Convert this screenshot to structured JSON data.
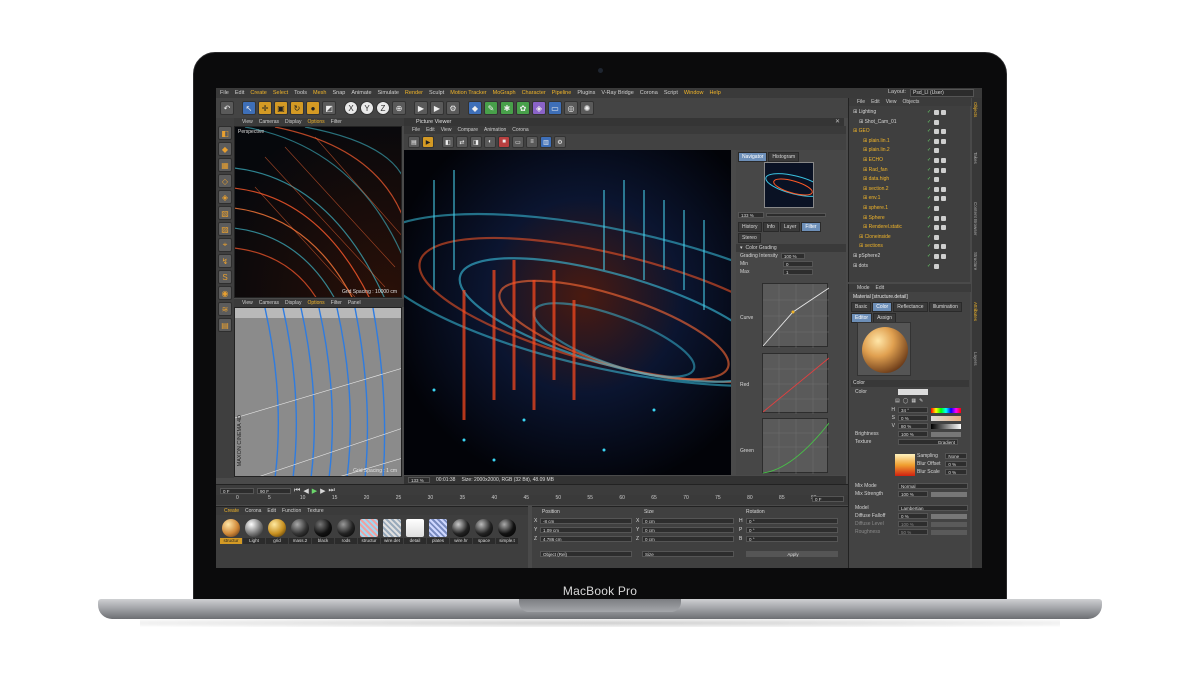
{
  "device": {
    "label": "MacBook Pro"
  },
  "menu": [
    "File",
    "Edit",
    "Create",
    "Select",
    "Tools",
    "Mesh",
    "Snap",
    "Animate",
    "Simulate",
    "Render",
    "Sculpt",
    "Motion Tracker",
    "MoGraph",
    "Character",
    "Pipeline",
    "Plugins",
    "V-Ray Bridge",
    "Corona",
    "Script",
    "Window",
    "Help"
  ],
  "menu_highlight": [
    "Create",
    "Select",
    "Mesh",
    "Render",
    "Motion Tracker",
    "MoGraph",
    "Character",
    "Pipeline",
    "Window",
    "Help"
  ],
  "layout": {
    "label": "Layout:",
    "value": "Psd_LI (User)"
  },
  "viewport_top": {
    "menu": [
      "View",
      "Cameras",
      "Display",
      "Options",
      "Filter"
    ],
    "label": "Perspective",
    "grid": "Grid Spacing : 10000 cm"
  },
  "viewport_bottom": {
    "menu": [
      "View",
      "Cameras",
      "Display",
      "Options",
      "Filter",
      "Panel"
    ],
    "grid": "Grid Spacing : 1 cm",
    "brand": "MAXON CINEMA 4D"
  },
  "picture_viewer": {
    "title": "Picture Viewer",
    "menu": [
      "File",
      "Edit",
      "View",
      "Compare",
      "Animation",
      "Corona"
    ],
    "tabs": [
      "Navigator",
      "Histogram"
    ],
    "zoom": "133 %",
    "subtabs": [
      "History",
      "Info",
      "Layer",
      "Filter",
      "Stereo"
    ],
    "section": "Color Grading",
    "grading_label": "Grading Intensity",
    "grading_value": "100 %",
    "min_label": "Min",
    "min_value": "0",
    "max_label": "Max",
    "max_value": "1",
    "curve_label": "Curve",
    "red_label": "Red",
    "green_label": "Green",
    "status_zoom": "133 %",
    "time": "00:01:38",
    "size_info": "Size: 2000x2000, RGB (32 Bit), 48.09 MB"
  },
  "timeline": {
    "start": "0 F",
    "end": "90 F",
    "ticks": [
      "0",
      "5",
      "10",
      "15",
      "20",
      "25",
      "30",
      "35",
      "40",
      "45",
      "50",
      "55",
      "60",
      "65",
      "70",
      "75",
      "80",
      "85",
      "90"
    ],
    "frame": "0 F"
  },
  "materials": {
    "tabs": [
      "Create",
      "Corona",
      "Edit",
      "Function",
      "Texture"
    ],
    "items": [
      "structur",
      "Light",
      "grid",
      "mass.2",
      "black",
      "rods",
      "structur",
      "wire.det",
      "detail",
      "plates",
      "wire.hr",
      "space",
      "simple.t"
    ]
  },
  "coordinates": {
    "headers": [
      "Position",
      "Size",
      "Rotation"
    ],
    "rows": [
      {
        "axis": "X",
        "pos": "-8 cm",
        "size": "0 cm",
        "rot_axis": "H",
        "rot": "0 °"
      },
      {
        "axis": "Y",
        "pos": "1.09 cm",
        "size": "0 cm",
        "rot_axis": "P",
        "rot": "0 °"
      },
      {
        "axis": "Z",
        "pos": "4.786 cm",
        "size": "0 cm",
        "rot_axis": "B",
        "rot": "0 °"
      }
    ],
    "mode": "Object (Rel)",
    "size_mode": "Size",
    "apply": "Apply"
  },
  "objects": {
    "menu": [
      "File",
      "Edit",
      "View",
      "Objects"
    ],
    "items": [
      "Lighting",
      "Shot_Cam_01",
      "GEO",
      "plain.lin.1",
      "plain.lin.2",
      "ECHO",
      "Rad_fan",
      "data.high",
      "section.2",
      "env.1",
      "sphere.1",
      "Sphere",
      "Renderel.static",
      "Cloneinside",
      "sections",
      "pSphere2",
      "dots"
    ]
  },
  "attributes": {
    "menu": [
      "Mode",
      "Edit"
    ],
    "material": "Material [structure.detail]",
    "tabs": [
      "Basic",
      "Color",
      "Reflectance",
      "Illumination",
      "Editor",
      "Assign"
    ],
    "section": "Color",
    "color_label": "Color",
    "h_label": "H",
    "h_value": "34 °",
    "s_label": "S",
    "s_value": "0 %",
    "v_label": "V",
    "v_value": "80 %",
    "brightness_label": "Brightness",
    "brightness_value": "100 %",
    "texture_label": "Texture",
    "gradient": "Gradient",
    "sampling_label": "Sampling",
    "sampling_value": "None",
    "bluroffset_label": "Blur Offset",
    "bluroffset_value": "0 %",
    "blurscale_label": "Blur Scale",
    "blurscale_value": "0 %",
    "mixmode_label": "Mix Mode",
    "mixmode_value": "Normal",
    "mixstrength_label": "Mix Strength",
    "mixstrength_value": "100 %",
    "model_label": "Model",
    "model_value": "Lambertian",
    "diffusefalloff_label": "Diffuse Falloff",
    "diffusefalloff_value": "0 %",
    "diffuselevel_label": "Diffuse Level",
    "diffuselevel_value": "100 %",
    "roughness_label": "Roughness",
    "roughness_value": "50 %"
  },
  "side_tabs": [
    "Objects",
    "Takes",
    "Content Browser",
    "Structure",
    "Attributes",
    "Layers"
  ]
}
